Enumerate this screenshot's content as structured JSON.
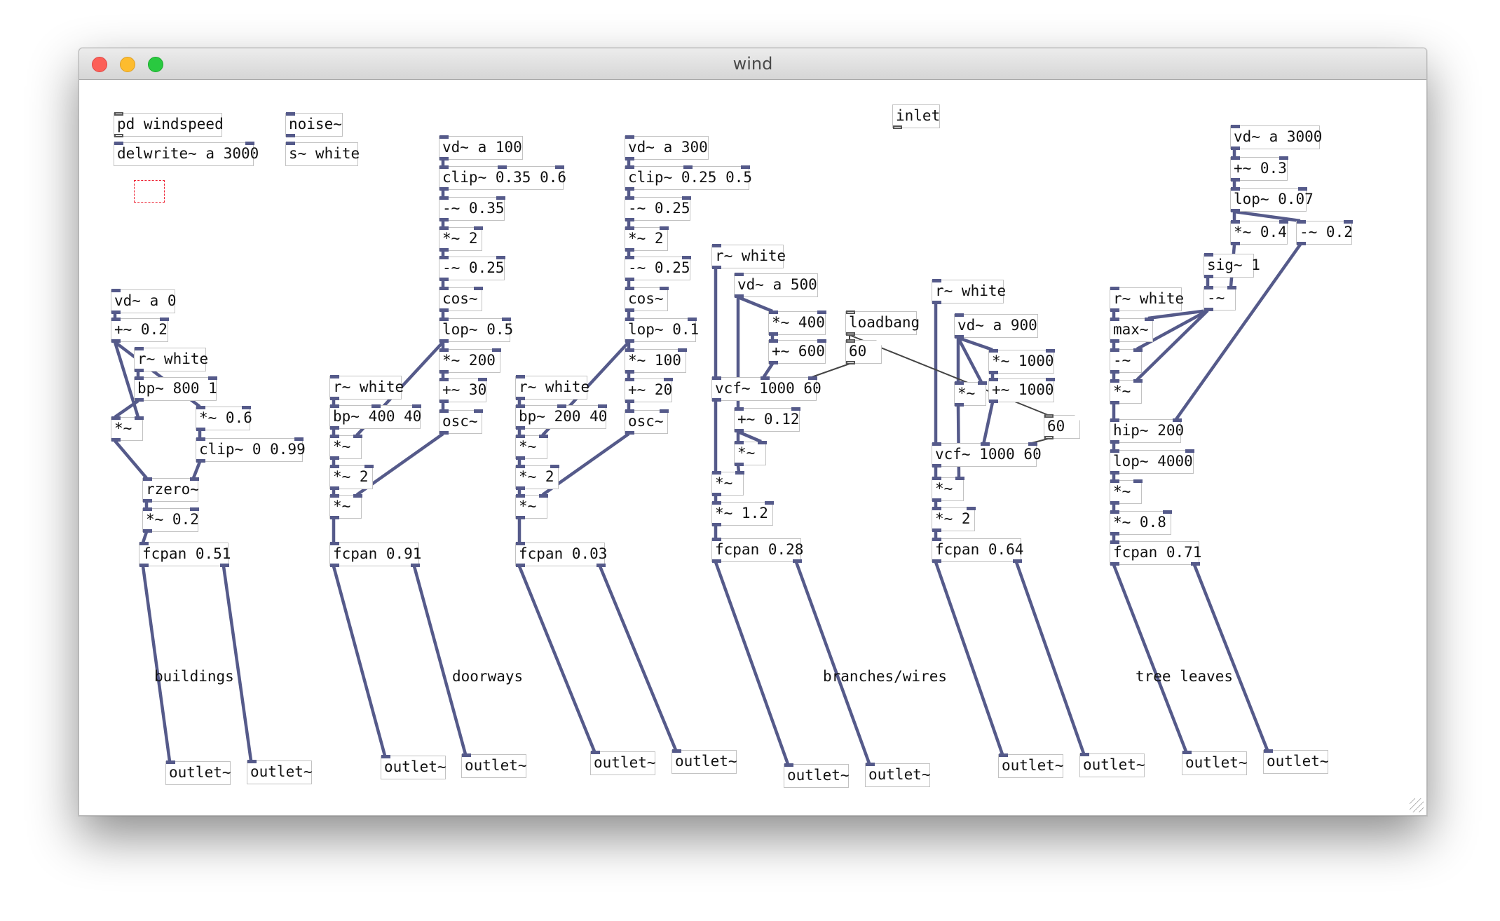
{
  "window": {
    "title": "wind"
  },
  "colors": {
    "audio_wire": "#555a8a",
    "box_border": "#c2c2c2",
    "selection": "#ee2233"
  },
  "objects": {
    "o1": "pd windspeed",
    "o2": "delwrite~ a 3000",
    "o3": "noise~",
    "o4": "s~ white",
    "o5": "inlet",
    "o6": "vd~ a 0",
    "o7": "+~ 0.2",
    "o8": "r~ white",
    "o9": "bp~ 800 1",
    "o10": "*~",
    "o11": "*~ 0.6",
    "o12": "clip~ 0 0.99",
    "o13": "rzero~",
    "o14": "*~ 0.2",
    "o15": "fcpan 0.51",
    "o16": "outlet~",
    "o17": "outlet~",
    "o18": "vd~ a 100",
    "o19": "clip~ 0.35 0.6",
    "o20": "-~ 0.35",
    "o21": "*~ 2",
    "o22": "-~ 0.25",
    "o23": "cos~",
    "o24": "lop~ 0.5",
    "o25": "*~ 200",
    "o26": "+~ 30",
    "o27": "osc~",
    "o28": "r~ white",
    "o29": "bp~ 400 40",
    "o30": "*~",
    "o31": "*~ 2",
    "o32": "*~",
    "o33": "fcpan 0.91",
    "o34": "outlet~",
    "o35": "outlet~",
    "o36": "vd~ a 300",
    "o37": "clip~ 0.25 0.5",
    "o38": "-~ 0.25",
    "o39": "*~ 2",
    "o40": "-~ 0.25",
    "o41": "cos~",
    "o42": "lop~ 0.1",
    "o43": "*~ 100",
    "o44": "+~ 20",
    "o45": "osc~",
    "o46": "r~ white",
    "o47": "bp~ 200 40",
    "o48": "*~",
    "o49": "*~ 2",
    "o50": "*~",
    "o51": "fcpan 0.03",
    "o52": "outlet~",
    "o53": "outlet~",
    "o54": "r~ white",
    "o55": "vd~ a 500",
    "o56": "*~ 400",
    "o57": "+~ 600",
    "o58": "vcf~ 1000 60",
    "o59": "+~ 0.12",
    "o60": "*~",
    "o61": "*~",
    "o62": "*~ 1.2",
    "o63": "fcpan 0.28",
    "o64": "outlet~",
    "o65": "outlet~",
    "o66": "loadbang",
    "o67": "60",
    "o68": "60",
    "o69": "r~ white",
    "o70": "vd~ a 900",
    "o71": "*~ 1000",
    "o72": "+~ 1000",
    "o73": "*~",
    "o74": "vcf~ 1000 60",
    "o75": "*~",
    "o76": "*~ 2",
    "o77": "fcpan 0.64",
    "o78": "outlet~",
    "o79": "outlet~",
    "o80": "vd~ a 3000",
    "o81": "+~ 0.3",
    "o82": "lop~ 0.07",
    "o83": "*~ 0.4",
    "o84": "-~ 0.2",
    "o85": "sig~ 1",
    "o86": "-~",
    "o87": "r~ white",
    "o88": "max~",
    "o89": "-~",
    "o90": "*~",
    "o91": "hip~ 200",
    "o92": "lop~ 4000",
    "o93": "*~",
    "o94": "*~ 0.8",
    "o95": "fcpan 0.71",
    "o96": "outlet~",
    "o97": "outlet~"
  },
  "comments": {
    "buildings": "buildings",
    "doorways": "doorways",
    "branches": "branches/wires",
    "leaves": "tree leaves"
  }
}
